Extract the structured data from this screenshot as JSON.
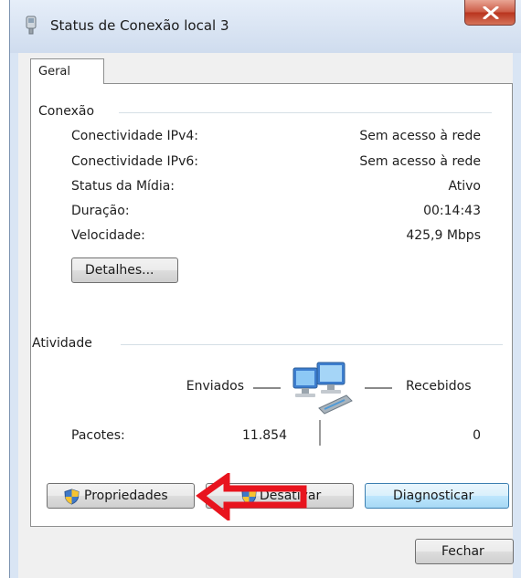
{
  "window": {
    "title": "Status de Conexão local 3",
    "close_icon": "close-icon",
    "title_icon": "network-adapter-icon"
  },
  "tabs": [
    {
      "label": "Geral"
    }
  ],
  "connection": {
    "group_label": "Conexão",
    "rows": [
      {
        "label": "Conectividade IPv4:",
        "value": "Sem acesso à rede"
      },
      {
        "label": "Conectividade IPv6:",
        "value": "Sem acesso à rede"
      },
      {
        "label": "Status da Mídia:",
        "value": "Ativo"
      },
      {
        "label": "Duração:",
        "value": "00:14:43"
      },
      {
        "label": "Velocidade:",
        "value": "425,9 Mbps"
      }
    ],
    "details_button": "Detalhes..."
  },
  "activity": {
    "group_label": "Atividade",
    "sent_label": "Enviados",
    "received_label": "Recebidos",
    "packets_label": "Pacotes:",
    "packets_sent": "11.854",
    "packets_received": "0",
    "network_icon": "network-computers-icon"
  },
  "buttons": {
    "properties": "Propriedades",
    "disable": "Desativar",
    "diagnose": "Diagnosticar",
    "close": "Fechar"
  },
  "annotation": {
    "arrow_color": "#e8141e",
    "icon": "red-arrow-icon"
  }
}
